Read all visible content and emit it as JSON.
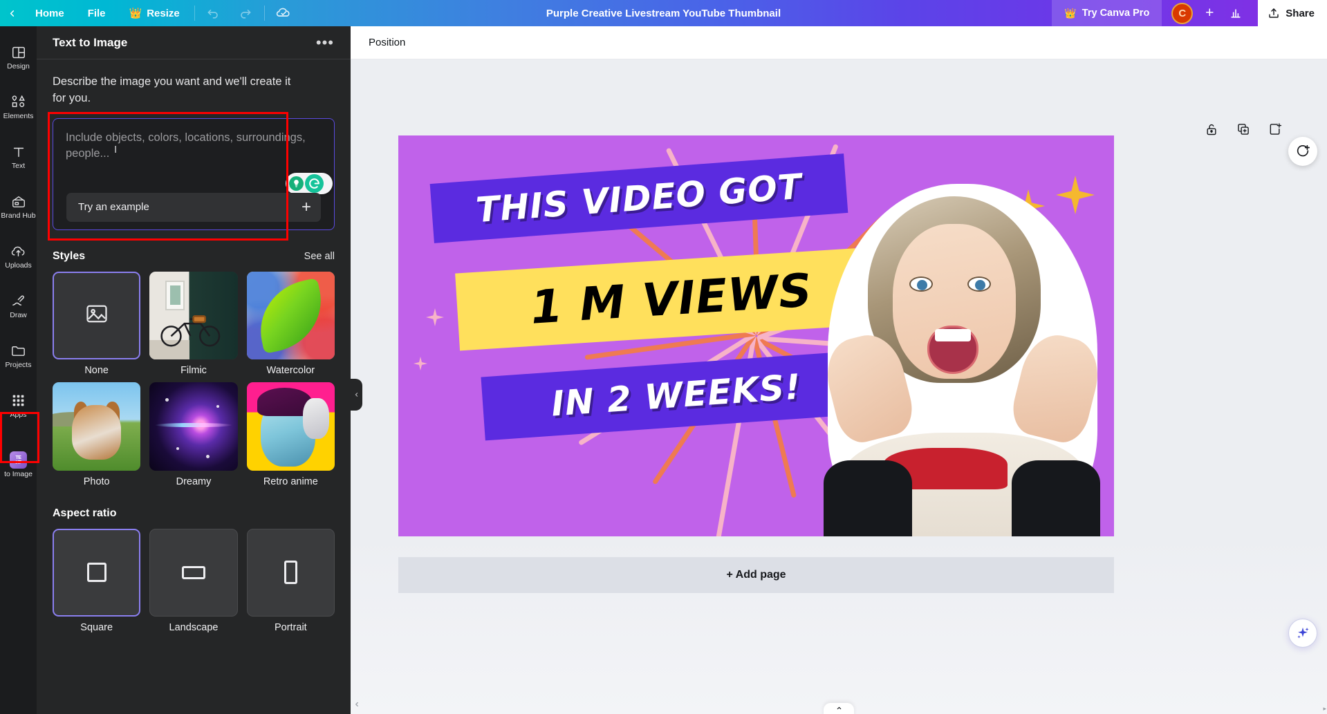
{
  "topbar": {
    "back_icon": "chevron-left-icon",
    "home_label": "Home",
    "file_label": "File",
    "resize_label": "Resize",
    "resize_badge_icon": "crown-icon",
    "undo_icon": "undo-icon",
    "redo_icon": "redo-icon",
    "cloud_saved_icon": "cloud-check-icon",
    "doc_title": "Purple Creative Livestream YouTube Thumbnail",
    "try_pro_label": "Try Canva Pro",
    "try_pro_icon": "crown-icon",
    "avatar_initial": "C",
    "plus_label": "+",
    "insights_icon": "bar-chart-icon",
    "share_label": "Share",
    "share_icon": "share-upload-icon",
    "gradient_start": "#00c4cc",
    "gradient_end": "#8a2be2"
  },
  "rail": {
    "items": [
      {
        "label": "Design",
        "icon": "layout-icon"
      },
      {
        "label": "Elements",
        "icon": "shapes-icon"
      },
      {
        "label": "Text",
        "icon": "text-t-icon"
      },
      {
        "label": "Brand Hub",
        "icon": "brand-card-icon"
      },
      {
        "label": "Uploads",
        "icon": "cloud-upload-icon"
      },
      {
        "label": "Draw",
        "icon": "pen-icon"
      },
      {
        "label": "Projects",
        "icon": "folder-icon"
      },
      {
        "label": "Apps",
        "icon": "grid-dots-icon"
      },
      {
        "label": "to Image",
        "icon": "text-to-image-app-icon"
      }
    ],
    "highlight_color": "#ff0000"
  },
  "panel": {
    "title": "Text to Image",
    "more_icon": "more-horizontal-icon",
    "description": "Describe the image you want and we'll create it for you.",
    "prompt": {
      "placeholder": "Include objects, colors, locations, surroundings, people...",
      "value": "",
      "try_example_label": "Try an example",
      "add_icon": "plus-icon",
      "grammarly_icon": "grammarly-logo-icon",
      "grammarly_bulb_icon": "lightbulb-icon",
      "border_color": "#5b4be0",
      "highlight_color": "#ff0000"
    },
    "styles": {
      "title": "Styles",
      "see_all_label": "See all",
      "items": [
        {
          "label": "None",
          "selected": true,
          "art": "none"
        },
        {
          "label": "Filmic",
          "selected": false,
          "art": "filmic"
        },
        {
          "label": "Watercolor",
          "selected": false,
          "art": "watercolor"
        },
        {
          "label": "Photo",
          "selected": false,
          "art": "photo"
        },
        {
          "label": "Dreamy",
          "selected": false,
          "art": "dreamy"
        },
        {
          "label": "Retro anime",
          "selected": false,
          "art": "retro"
        }
      ],
      "selected_border": "#8b7ff0"
    },
    "aspect_ratio": {
      "title": "Aspect ratio",
      "items": [
        {
          "label": "Square",
          "selected": true,
          "glyph": "square"
        },
        {
          "label": "Landscape",
          "selected": false,
          "glyph": "landscape"
        },
        {
          "label": "Portrait",
          "selected": false,
          "glyph": "portrait"
        }
      ]
    },
    "collapse_icon": "chevron-left-icon"
  },
  "main": {
    "context_toolbar": {
      "position_label": "Position"
    },
    "page_tools": [
      {
        "icon": "lock-icon",
        "name": "lock-page"
      },
      {
        "icon": "duplicate-icon",
        "name": "duplicate-page"
      },
      {
        "icon": "add-page-icon",
        "name": "add-page-after"
      }
    ],
    "comment_icon": "comment-add-icon",
    "magic_icon": "magic-sparkle-icon",
    "add_page_label": "+ Add page",
    "bottom_chevron_icon": "chevron-up-icon",
    "scroll_left_icon": "chevron-left-small-icon",
    "design": {
      "background_color": "#c062ea",
      "text_boxes": [
        {
          "text": "THIS VIDEO GOT",
          "bg": "#5b2be0",
          "fg": "#ffffff"
        },
        {
          "text": "1 M VIEWS",
          "bg": "#ffe05c",
          "fg": "#000000"
        },
        {
          "text": "IN 2 WEEKS!",
          "bg": "#5b2be0",
          "fg": "#ffffff"
        }
      ],
      "sparkle_color": "#f5b82e",
      "ray_colors": [
        "#f58a5b",
        "#f7b3c8",
        "#ef7a52"
      ]
    }
  }
}
